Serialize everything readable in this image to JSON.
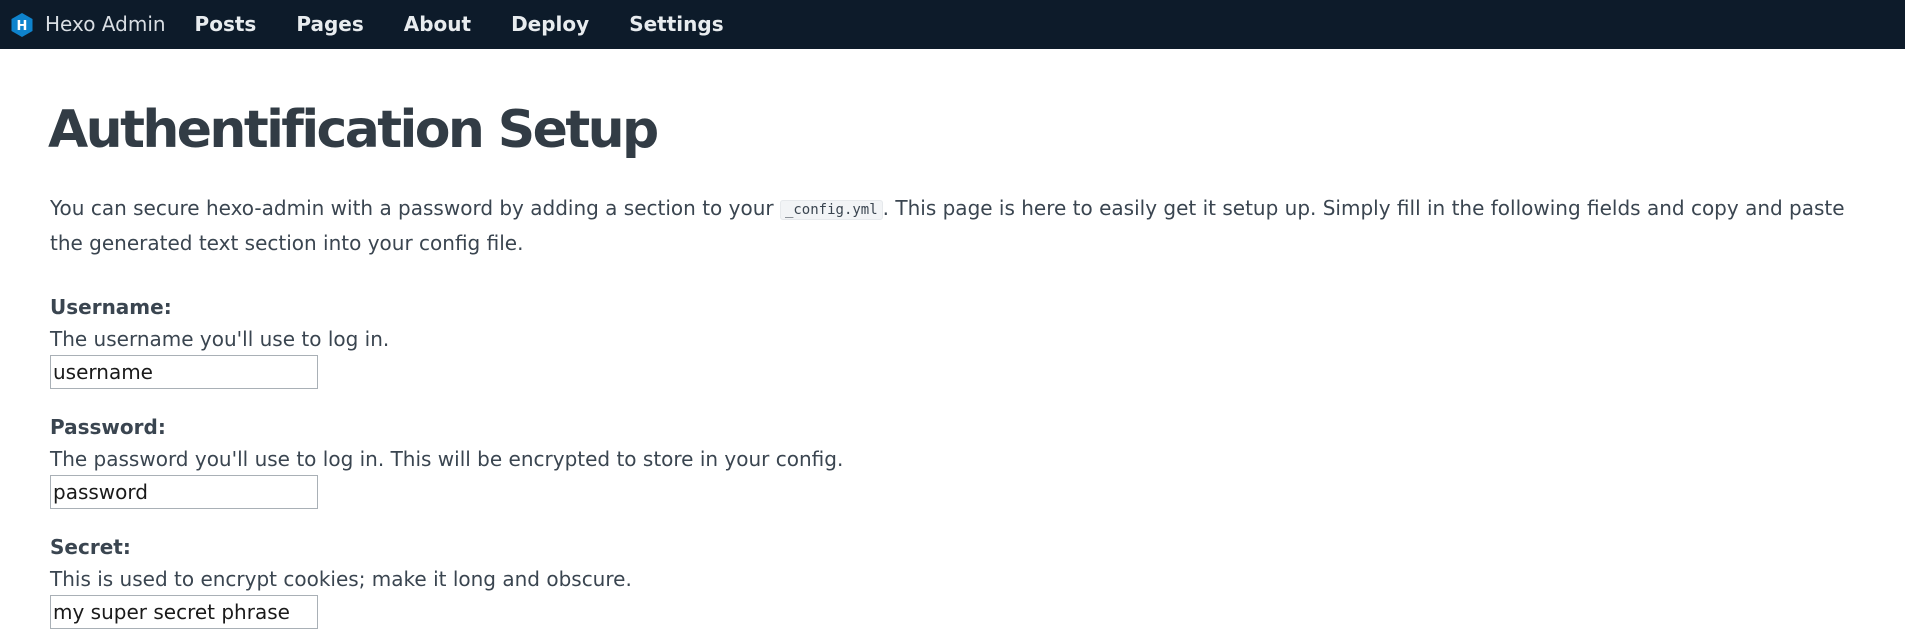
{
  "app": {
    "brand_icon": "hexo-logo-icon",
    "brand_icon_letter": "H",
    "brand_color": "#0e83cd",
    "title": "Hexo Admin"
  },
  "nav": {
    "items": [
      {
        "label": "Posts"
      },
      {
        "label": "Pages"
      },
      {
        "label": "About"
      },
      {
        "label": "Deploy"
      },
      {
        "label": "Settings"
      }
    ]
  },
  "page": {
    "title": "Authentification Setup",
    "intro_before": "You can secure hexo-admin with a password by adding a section to your ",
    "intro_code": "_config.yml",
    "intro_after": ". This page is here to easily get it setup up. Simply fill in the following fields and copy and paste the generated text section into your config file."
  },
  "fields": {
    "username": {
      "label": "Username:",
      "help": "The username you'll use to log in.",
      "value": "username"
    },
    "password": {
      "label": "Password:",
      "help": "The password you'll use to log in. This will be encrypted to store in your config.",
      "value": "password"
    },
    "secret": {
      "label": "Secret:",
      "help": "This is used to encrypt cookies; make it long and obscure.",
      "value": "my super secret phrase"
    }
  }
}
